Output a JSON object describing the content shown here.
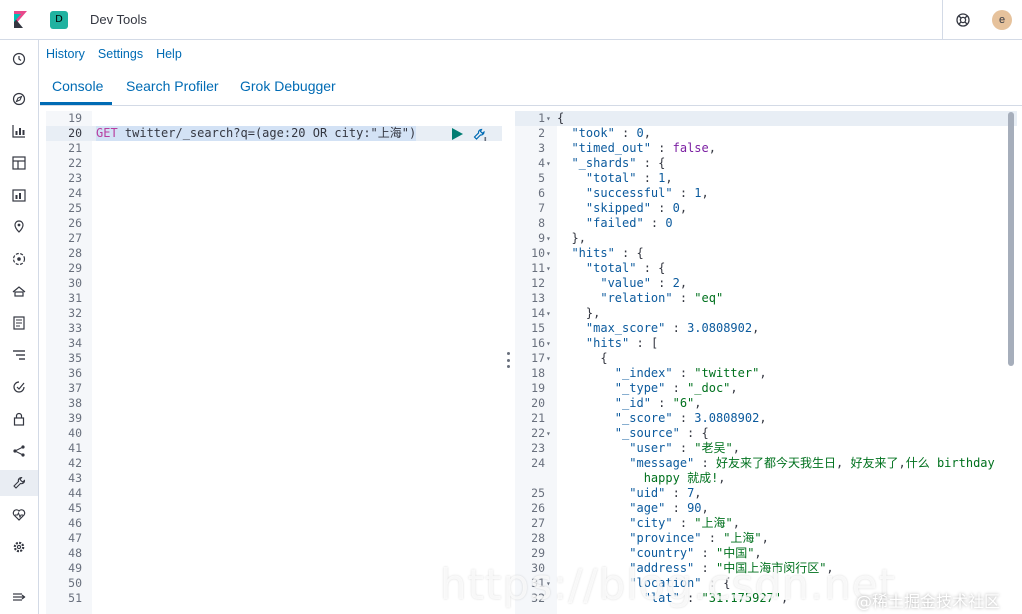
{
  "header": {
    "space_initial": "D",
    "app_title": "Dev Tools",
    "avatar_initial": "e"
  },
  "menu": {
    "history": "History",
    "settings": "Settings",
    "help": "Help"
  },
  "tabs": [
    {
      "label": "Console",
      "active": true
    },
    {
      "label": "Search Profiler",
      "active": false
    },
    {
      "label": "Grok Debugger",
      "active": false
    }
  ],
  "request_editor": {
    "line_numbers": [
      "19",
      "20",
      "21",
      "22",
      "23",
      "24",
      "25",
      "26",
      "27",
      "28",
      "29",
      "30",
      "31",
      "32",
      "33",
      "34",
      "35",
      "36",
      "37",
      "38",
      "39",
      "40",
      "41",
      "42",
      "43",
      "44",
      "45",
      "46",
      "47",
      "48",
      "49",
      "50",
      "51"
    ],
    "request_method": "GET",
    "request_path": " twitter/_search?q=(age:20 OR city:\"上海\")"
  },
  "response_editor": {
    "lines": [
      {
        "n": "1",
        "fold": true,
        "t": "{"
      },
      {
        "n": "2",
        "t": "  \"took\" : 0,"
      },
      {
        "n": "3",
        "t": "  \"timed_out\" : false,"
      },
      {
        "n": "4",
        "fold": true,
        "t": "  \"_shards\" : {"
      },
      {
        "n": "5",
        "t": "    \"total\" : 1,"
      },
      {
        "n": "6",
        "t": "    \"successful\" : 1,"
      },
      {
        "n": "7",
        "t": "    \"skipped\" : 0,"
      },
      {
        "n": "8",
        "t": "    \"failed\" : 0"
      },
      {
        "n": "9",
        "fold": true,
        "t": "  },"
      },
      {
        "n": "10",
        "fold": true,
        "t": "  \"hits\" : {"
      },
      {
        "n": "11",
        "fold": true,
        "t": "    \"total\" : {"
      },
      {
        "n": "12",
        "t": "      \"value\" : 2,"
      },
      {
        "n": "13",
        "t": "      \"relation\" : \"eq\""
      },
      {
        "n": "14",
        "fold": true,
        "t": "    },"
      },
      {
        "n": "15",
        "t": "    \"max_score\" : 3.0808902,"
      },
      {
        "n": "16",
        "fold": true,
        "t": "    \"hits\" : ["
      },
      {
        "n": "17",
        "fold": true,
        "t": "      {"
      },
      {
        "n": "18",
        "t": "        \"_index\" : \"twitter\","
      },
      {
        "n": "19",
        "t": "        \"_type\" : \"_doc\","
      },
      {
        "n": "20",
        "t": "        \"_id\" : \"6\","
      },
      {
        "n": "21",
        "t": "        \"_score\" : 3.0808902,"
      },
      {
        "n": "22",
        "fold": true,
        "t": "        \"_source\" : {"
      },
      {
        "n": "23",
        "t": "          \"user\" : \"老吴\","
      },
      {
        "n": "24",
        "t": "          \"message\" : \"好友来了都今天我生日, 好友来了,什么 birthday"
      },
      {
        "n": "",
        "t": "            happy 就成!\","
      },
      {
        "n": "25",
        "t": "          \"uid\" : 7,"
      },
      {
        "n": "26",
        "t": "          \"age\" : 90,"
      },
      {
        "n": "27",
        "t": "          \"city\" : \"上海\","
      },
      {
        "n": "28",
        "t": "          \"province\" : \"上海\","
      },
      {
        "n": "29",
        "t": "          \"country\" : \"中国\","
      },
      {
        "n": "30",
        "t": "          \"address\" : \"中国上海市闵行区\","
      },
      {
        "n": "31",
        "fold": true,
        "t": "          \"location\" : {"
      },
      {
        "n": "32",
        "t": "            \"lat\" : \"31.175927\","
      }
    ]
  },
  "watermark": "https://blog.csdn.net",
  "watermark_cn": "@稀土掘金技术社区",
  "colors": {
    "accent": "#006bb4",
    "space_badge": "#20b2a0",
    "border": "#d3dae6"
  }
}
